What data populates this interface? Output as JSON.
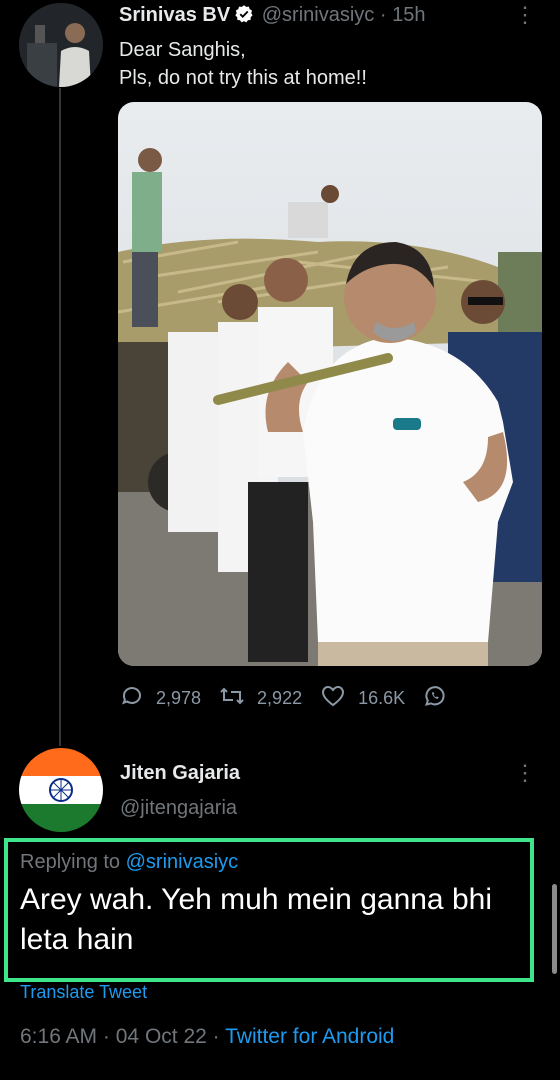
{
  "tweet": {
    "author_name": "Srinivas BV",
    "verified": true,
    "handle": "@srinivasiyc",
    "time": "15h",
    "dot": "·",
    "text_line1": "Dear Sanghis,",
    "text_line2": "Pls, do not try this at home!!",
    "more_icon": "⋮",
    "stats": {
      "replies": "2,978",
      "retweets": "2,922",
      "likes": "16.6K"
    }
  },
  "reply": {
    "author_name": "Jiten Gajaria",
    "handle": "@jitengajaria",
    "replying_prefix": "Replying to",
    "replying_to": "@srinivasiyc",
    "text": "Arey wah. Yeh muh mein ganna bhi leta hain",
    "translate": "Translate Tweet",
    "time": "6:16 AM",
    "sep": "·",
    "date": "04 Oct 22",
    "source": "Twitter for Android",
    "more_icon": "⋮"
  },
  "colors": {
    "background": "#000000",
    "link": "#1d9bf0",
    "highlight": "#3ee58a",
    "muted": "#71767b"
  }
}
